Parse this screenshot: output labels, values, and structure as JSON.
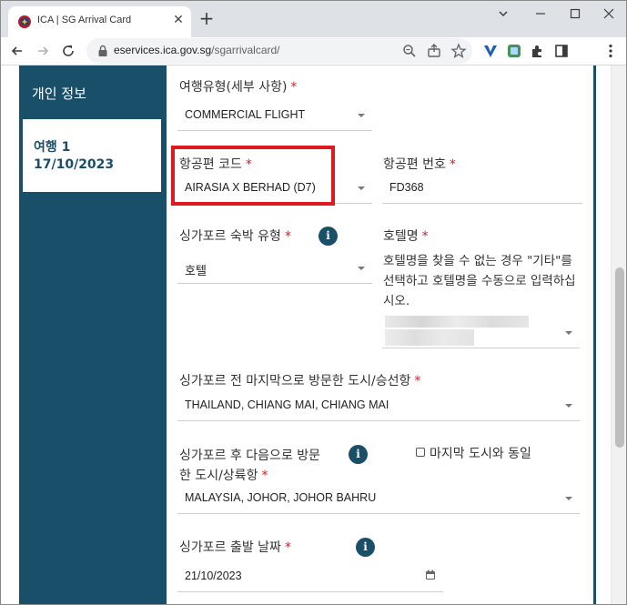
{
  "browser": {
    "tab_title": "ICA | SG Arrival Card",
    "url_host": "eservices.ica.gov.sg",
    "url_path": "/sgarrivalcard/"
  },
  "sidebar": {
    "personal_info": "개인 정보",
    "trip_label": "여행 1",
    "trip_date": "17/10/2023"
  },
  "form": {
    "travel_type": {
      "label": "여행유형(세부 사항)",
      "required": "*",
      "value": "COMMERCIAL FLIGHT"
    },
    "airline_code": {
      "label": "항공편 코드",
      "required": "*",
      "value": "AIRASIA X BERHAD (D7)"
    },
    "flight_number": {
      "label": "항공편 번호",
      "required": "*",
      "value": "FD368"
    },
    "accommodation_type": {
      "label": "싱가포르 숙박 유형",
      "required": "*",
      "value": "호텔"
    },
    "hotel_name": {
      "label": "호텔명",
      "required": "*",
      "hint": "호텔명을 찾을 수 없는 경우 \"기타\"를 선택하고 호텔명을 수동으로 입력하십시오."
    },
    "last_city": {
      "label": "싱가포르 전 마지막으로 방문한 도시/승선항",
      "required": "*",
      "value": "THAILAND, CHIANG MAI, CHIANG MAI"
    },
    "next_city": {
      "label_line1": "싱가포르 후 다음으로 방문",
      "label_line2": "한 도시/상륙항",
      "required": "*",
      "value": "MALAYSIA, JOHOR, JOHOR BAHRU"
    },
    "same_as_last": {
      "label": "마지막 도시와 동일"
    },
    "departure_date": {
      "label": "싱가포르 출발 날짜",
      "required": "*",
      "value": "21/10/2023"
    }
  },
  "colors": {
    "sidebar": "#1a4f6a",
    "required": "#d21f27",
    "highlight": "#e0191f"
  }
}
